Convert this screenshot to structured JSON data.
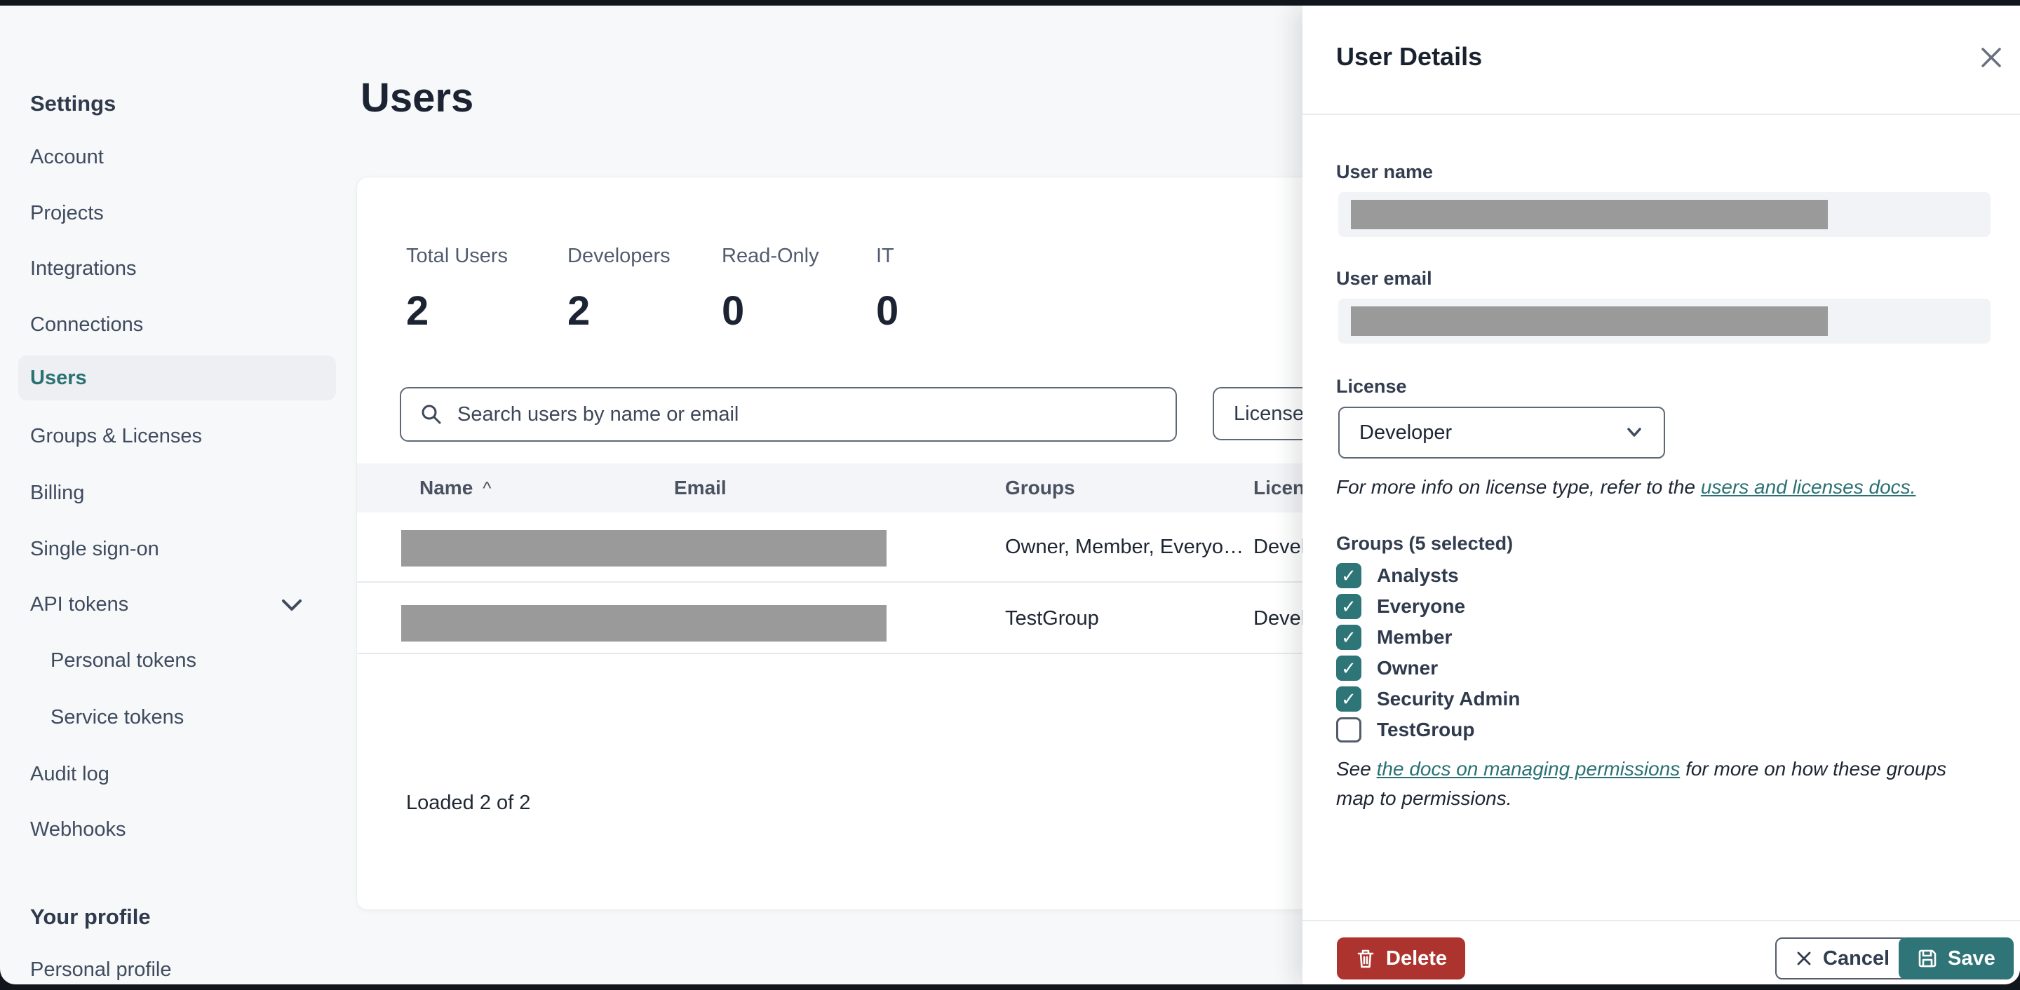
{
  "colors": {
    "accent_teal": "#2a7174",
    "save_teal": "#2f7476",
    "delete_red": "#ad342e",
    "checkbox_teal": "#2e7578",
    "page_bg": "#f7f8fa",
    "redact_gray": "#9a9a9a"
  },
  "sidebar": {
    "settings_heading": "Settings",
    "items": [
      {
        "label": "Account"
      },
      {
        "label": "Projects"
      },
      {
        "label": "Integrations"
      },
      {
        "label": "Connections"
      },
      {
        "label": "Users",
        "active": true
      },
      {
        "label": "Groups & Licenses"
      },
      {
        "label": "Billing"
      },
      {
        "label": "Single sign-on"
      },
      {
        "label": "API tokens",
        "has_chevron": true
      },
      {
        "label": "Personal tokens",
        "child": true
      },
      {
        "label": "Service tokens",
        "child": true
      },
      {
        "label": "Audit log"
      },
      {
        "label": "Webhooks"
      }
    ],
    "profile_heading": "Your profile",
    "profile_items": [
      {
        "label": "Personal profile"
      }
    ]
  },
  "main": {
    "title": "Users",
    "stats": [
      {
        "label": "Total Users",
        "value": "2"
      },
      {
        "label": "Developers",
        "value": "2"
      },
      {
        "label": "Read-Only",
        "value": "0"
      },
      {
        "label": "IT",
        "value": "0"
      }
    ],
    "search": {
      "placeholder": "Search users by name or email"
    },
    "license_filter_label": "License",
    "table": {
      "columns": {
        "name": "Name",
        "email": "Email",
        "groups": "Groups",
        "license": "License"
      },
      "rows": [
        {
          "groups": "Owner, Member, Everyo…",
          "license": "Developer"
        },
        {
          "groups": "TestGroup",
          "license": "Developer"
        }
      ]
    },
    "footer_status": "Loaded 2 of 2"
  },
  "panel": {
    "title": "User Details",
    "user_name_label": "User name",
    "user_email_label": "User email",
    "license_label": "License",
    "license_value": "Developer",
    "license_note_prefix": "For more info on license type, refer to the ",
    "license_note_link": "users and licenses docs.",
    "groups_label": "Groups (5 selected)",
    "group_options": [
      {
        "label": "Analysts",
        "checked": true
      },
      {
        "label": "Everyone",
        "checked": true
      },
      {
        "label": "Member",
        "checked": true
      },
      {
        "label": "Owner",
        "checked": true
      },
      {
        "label": "Security Admin",
        "checked": true
      },
      {
        "label": "TestGroup",
        "checked": false
      }
    ],
    "permissions_note_prefix": "See ",
    "permissions_note_link": "the docs on managing permissions",
    "permissions_note_suffix": " for more on how these groups map to permissions.",
    "actions": {
      "delete": "Delete",
      "cancel": "Cancel",
      "save": "Save"
    }
  }
}
